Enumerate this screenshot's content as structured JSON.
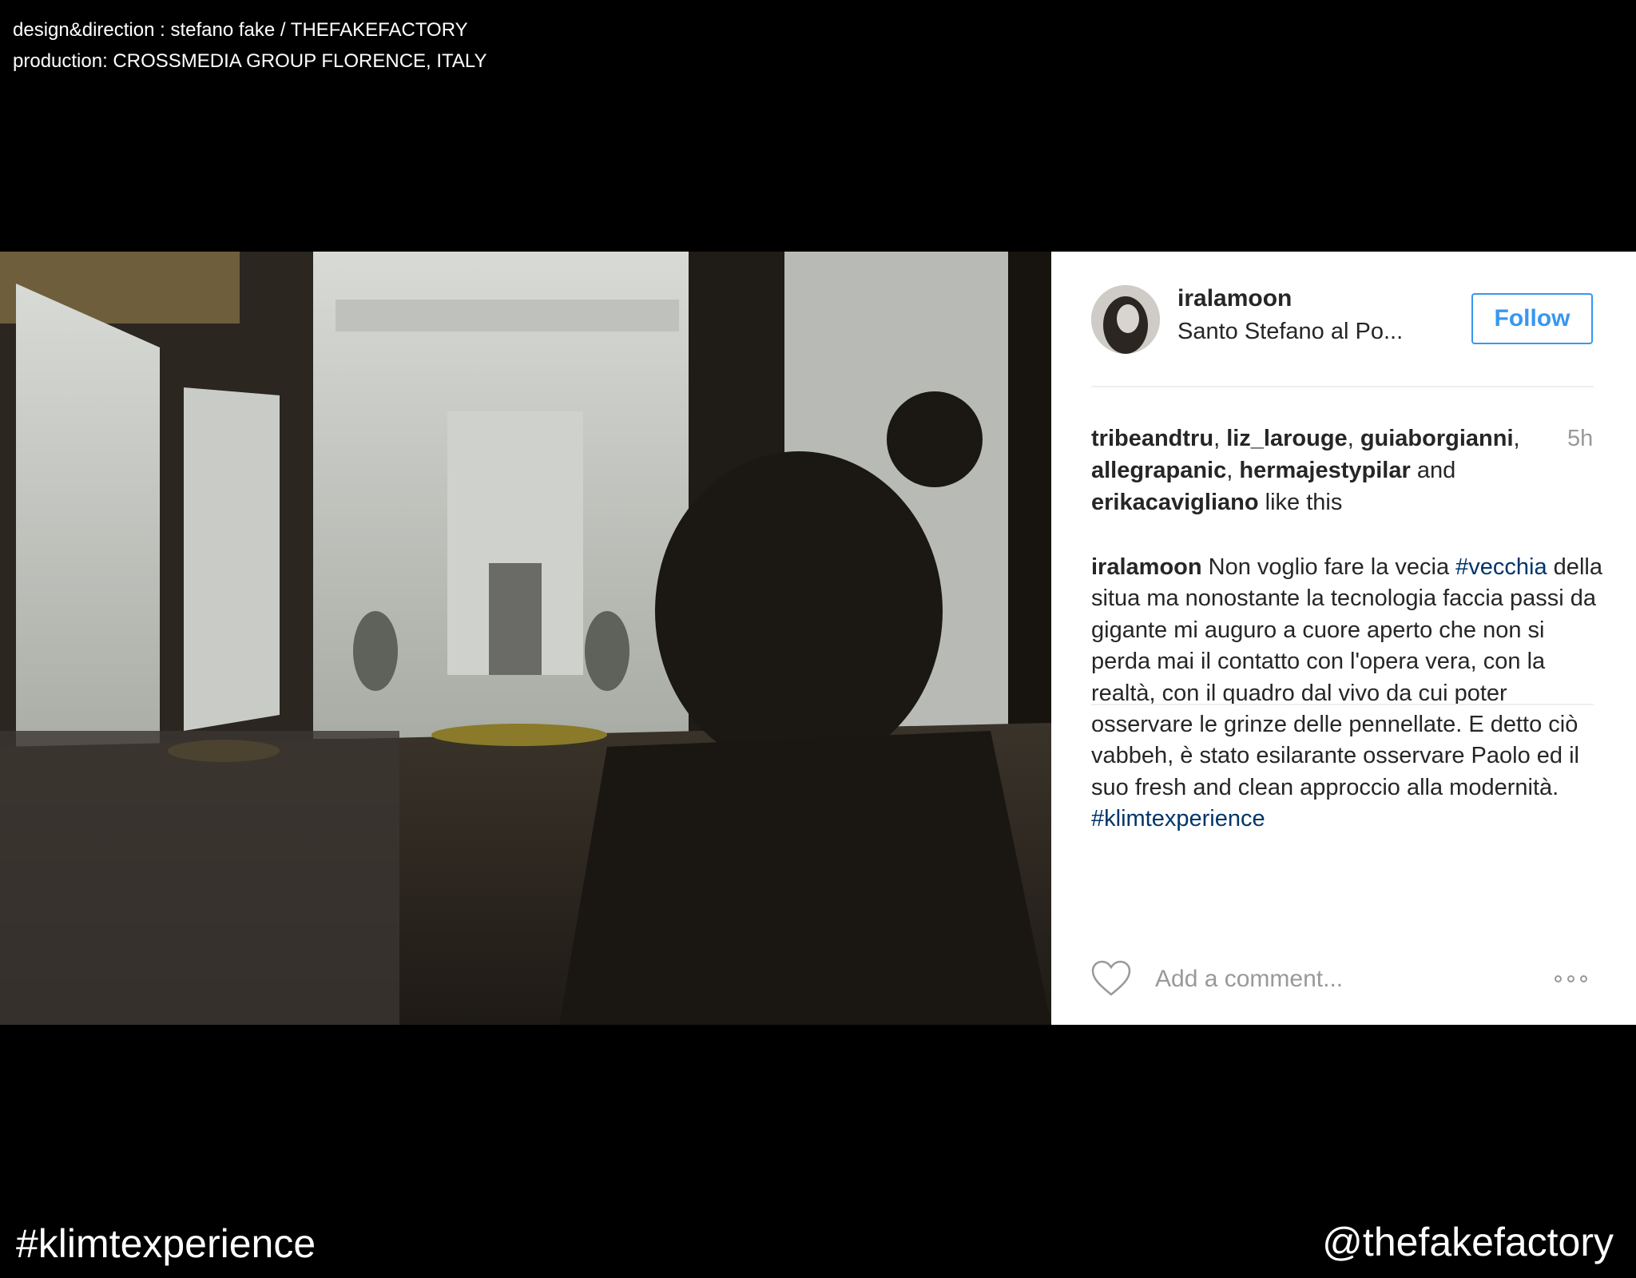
{
  "credits": {
    "line1": "design&direction : stefano fake / THEFAKEFACTORY",
    "line2": "production: CROSSMEDIA GROUP FLORENCE, ITALY"
  },
  "post": {
    "username": "iralamoon",
    "location": "Santo Stefano al Po...",
    "follow_label": "Follow",
    "time": "5h",
    "likes": {
      "users": [
        "tribeandtru",
        "liz_larouge",
        "guiaborgianni",
        "allegrapanic",
        "hermajestypilar",
        "erikacavigliano"
      ],
      "separator": ", ",
      "and_text": " and ",
      "suffix": " like this"
    },
    "caption": {
      "author": "iralamoon",
      "text_1": " Non voglio fare la vecia ",
      "hashtag_1": "#vecchia",
      "text_2": " della situa ma nonostante la tecnologia faccia passi da gigante mi auguro a cuore aperto che non si perda mai il contatto con l'opera vera, con la realtà, con il quadro dal vivo da cui poter osservare le grinze delle pennellate. E detto ciò vabbeh, è stato esilarante osservare Paolo ed il suo fresh and clean approccio alla modernità. ",
      "hashtag_2": "#klimtexperience"
    },
    "comment_placeholder": "Add a comment...",
    "accent_color": "#3897f0",
    "hashtag_color": "#003569"
  },
  "footer": {
    "hashtag": "#klimtexperience",
    "handle": "@thefakefactory"
  }
}
